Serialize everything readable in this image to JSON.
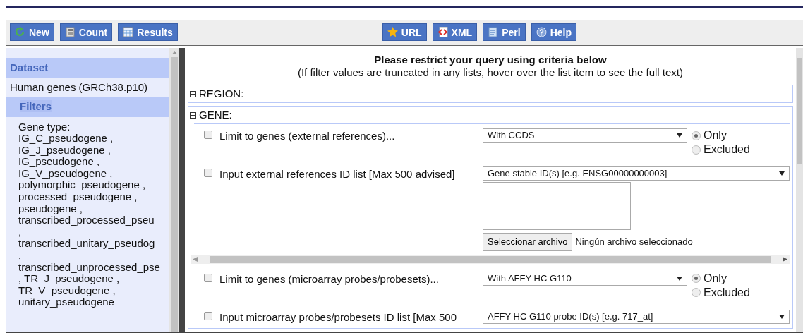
{
  "toolbar": {
    "left_buttons": [
      {
        "label": "New"
      },
      {
        "label": "Count"
      },
      {
        "label": "Results"
      }
    ],
    "right_buttons": [
      {
        "label": "URL"
      },
      {
        "label": "XML"
      },
      {
        "label": "Perl"
      },
      {
        "label": "Help"
      }
    ]
  },
  "sidebar": {
    "dataset_heading": "Dataset",
    "dataset": "Human genes (GRCh38.p10)",
    "filters_heading": "Filters",
    "filter_lines": [
      "Gene type:",
      "IG_C_pseudogene ,",
      "IG_J_pseudogene ,",
      "IG_pseudogene ,",
      "IG_V_pseudogene ,",
      "polymorphic_pseudogene ,",
      "processed_pseudogene ,",
      "pseudogene ,",
      "transcribed_processed_pseu",
      ",",
      "transcribed_unitary_pseudog",
      ",",
      "transcribed_unprocessed_pse",
      ", TR_J_pseudogene ,",
      "TR_V_pseudogene ,",
      "unitary_pseudogene"
    ]
  },
  "main": {
    "title": "Please restrict your query using criteria below",
    "subtitle": "(If filter values are truncated in any lists, hover over the list item to see the full text)",
    "sections": [
      {
        "name": "REGION:",
        "expanded": false
      },
      {
        "name": "GENE:",
        "expanded": true,
        "filters": [
          {
            "kind": "select",
            "checked": false,
            "label": "Limit to genes (external references)...",
            "select": "With CCDS",
            "options": [
              {
                "label": "Only",
                "selected": true
              },
              {
                "label": "Excluded",
                "selected": false
              }
            ]
          },
          {
            "kind": "idlist",
            "checked": false,
            "label": "Input external references ID list [Max 500 advised]",
            "select": "Gene stable ID(s) [e.g. ENSG00000000003]",
            "file_button": "Seleccionar archivo",
            "file_status": "Ningún archivo seleccionado"
          },
          {
            "kind": "select",
            "checked": false,
            "label": "Limit to genes (microarray probes/probesets)...",
            "select": "With AFFY HC G110",
            "options": [
              {
                "label": "Only",
                "selected": true
              },
              {
                "label": "Excluded",
                "selected": false
              }
            ]
          },
          {
            "kind": "idlist_cut",
            "checked": false,
            "label": "Input microarray probes/probesets ID list [Max 500",
            "select": "AFFY HC G110 probe ID(s) [e.g. 717_at]"
          }
        ]
      }
    ]
  }
}
